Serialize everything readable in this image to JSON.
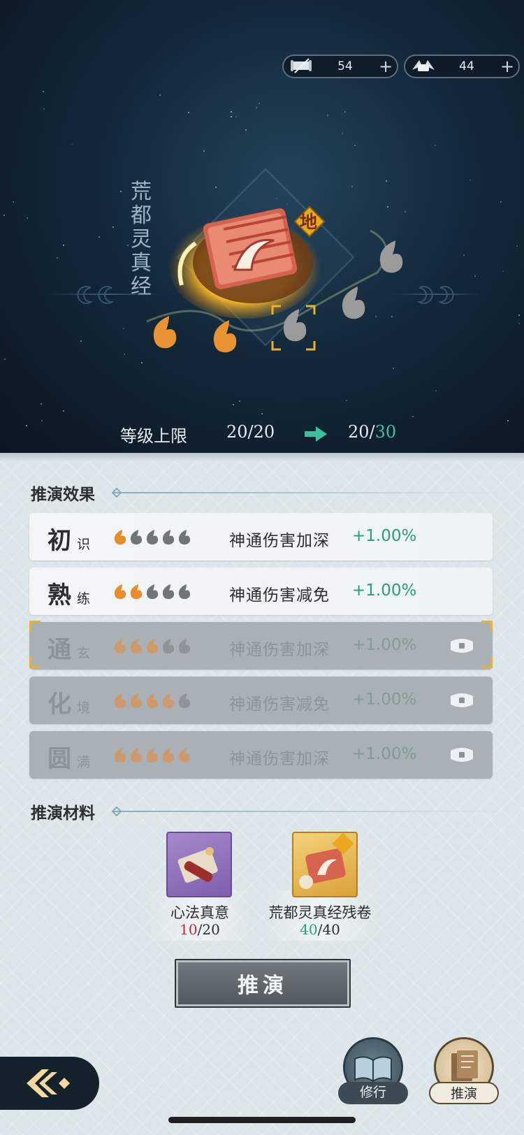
{
  "currencies": [
    {
      "icon": "scroll-icon",
      "value": "54",
      "plus": "+"
    },
    {
      "icon": "winged-scroll-icon",
      "value": "44",
      "plus": "+"
    }
  ],
  "technique": {
    "title_chars": [
      "荒",
      "都",
      "灵",
      "真",
      "经"
    ],
    "grade": "地",
    "filled_drops": 2,
    "total_drops": 5
  },
  "level": {
    "label": "等级上限",
    "current": "20/20",
    "next_prefix": "20/",
    "next_cap": "30"
  },
  "effects": {
    "title": "推演效果",
    "rows": [
      {
        "big": "初",
        "small": "识",
        "filled": 1,
        "desc": "神通伤害加深",
        "bonus": "+1.00%",
        "locked": false
      },
      {
        "big": "熟",
        "small": "练",
        "filled": 2,
        "desc": "神通伤害减免",
        "bonus": "+1.00%",
        "locked": false
      },
      {
        "big": "通",
        "small": "玄",
        "filled": 3,
        "desc": "神通伤害加深",
        "bonus": "+1.00%",
        "locked": true
      },
      {
        "big": "化",
        "small": "境",
        "filled": 4,
        "desc": "神通伤害减免",
        "bonus": "+1.00%",
        "locked": true
      },
      {
        "big": "圆",
        "small": "满",
        "filled": 5,
        "desc": "神通伤害加深",
        "bonus": "+1.00%",
        "locked": true
      }
    ]
  },
  "materials": {
    "title": "推演材料",
    "items": [
      {
        "name": "心法真意",
        "have": "10",
        "sep": "/",
        "need": "20",
        "enough": false
      },
      {
        "name": "荒都灵真经残卷",
        "have": "40",
        "sep": "/",
        "need": "40",
        "enough": true
      }
    ]
  },
  "action_button": "推演",
  "nav": {
    "practice": "修行",
    "deduce": "推演"
  },
  "colors": {
    "accent_green": "#38c2a0",
    "bonus_green": "#2c9b84",
    "shortage_red": "#c0283a",
    "gold": "#e6b232"
  }
}
